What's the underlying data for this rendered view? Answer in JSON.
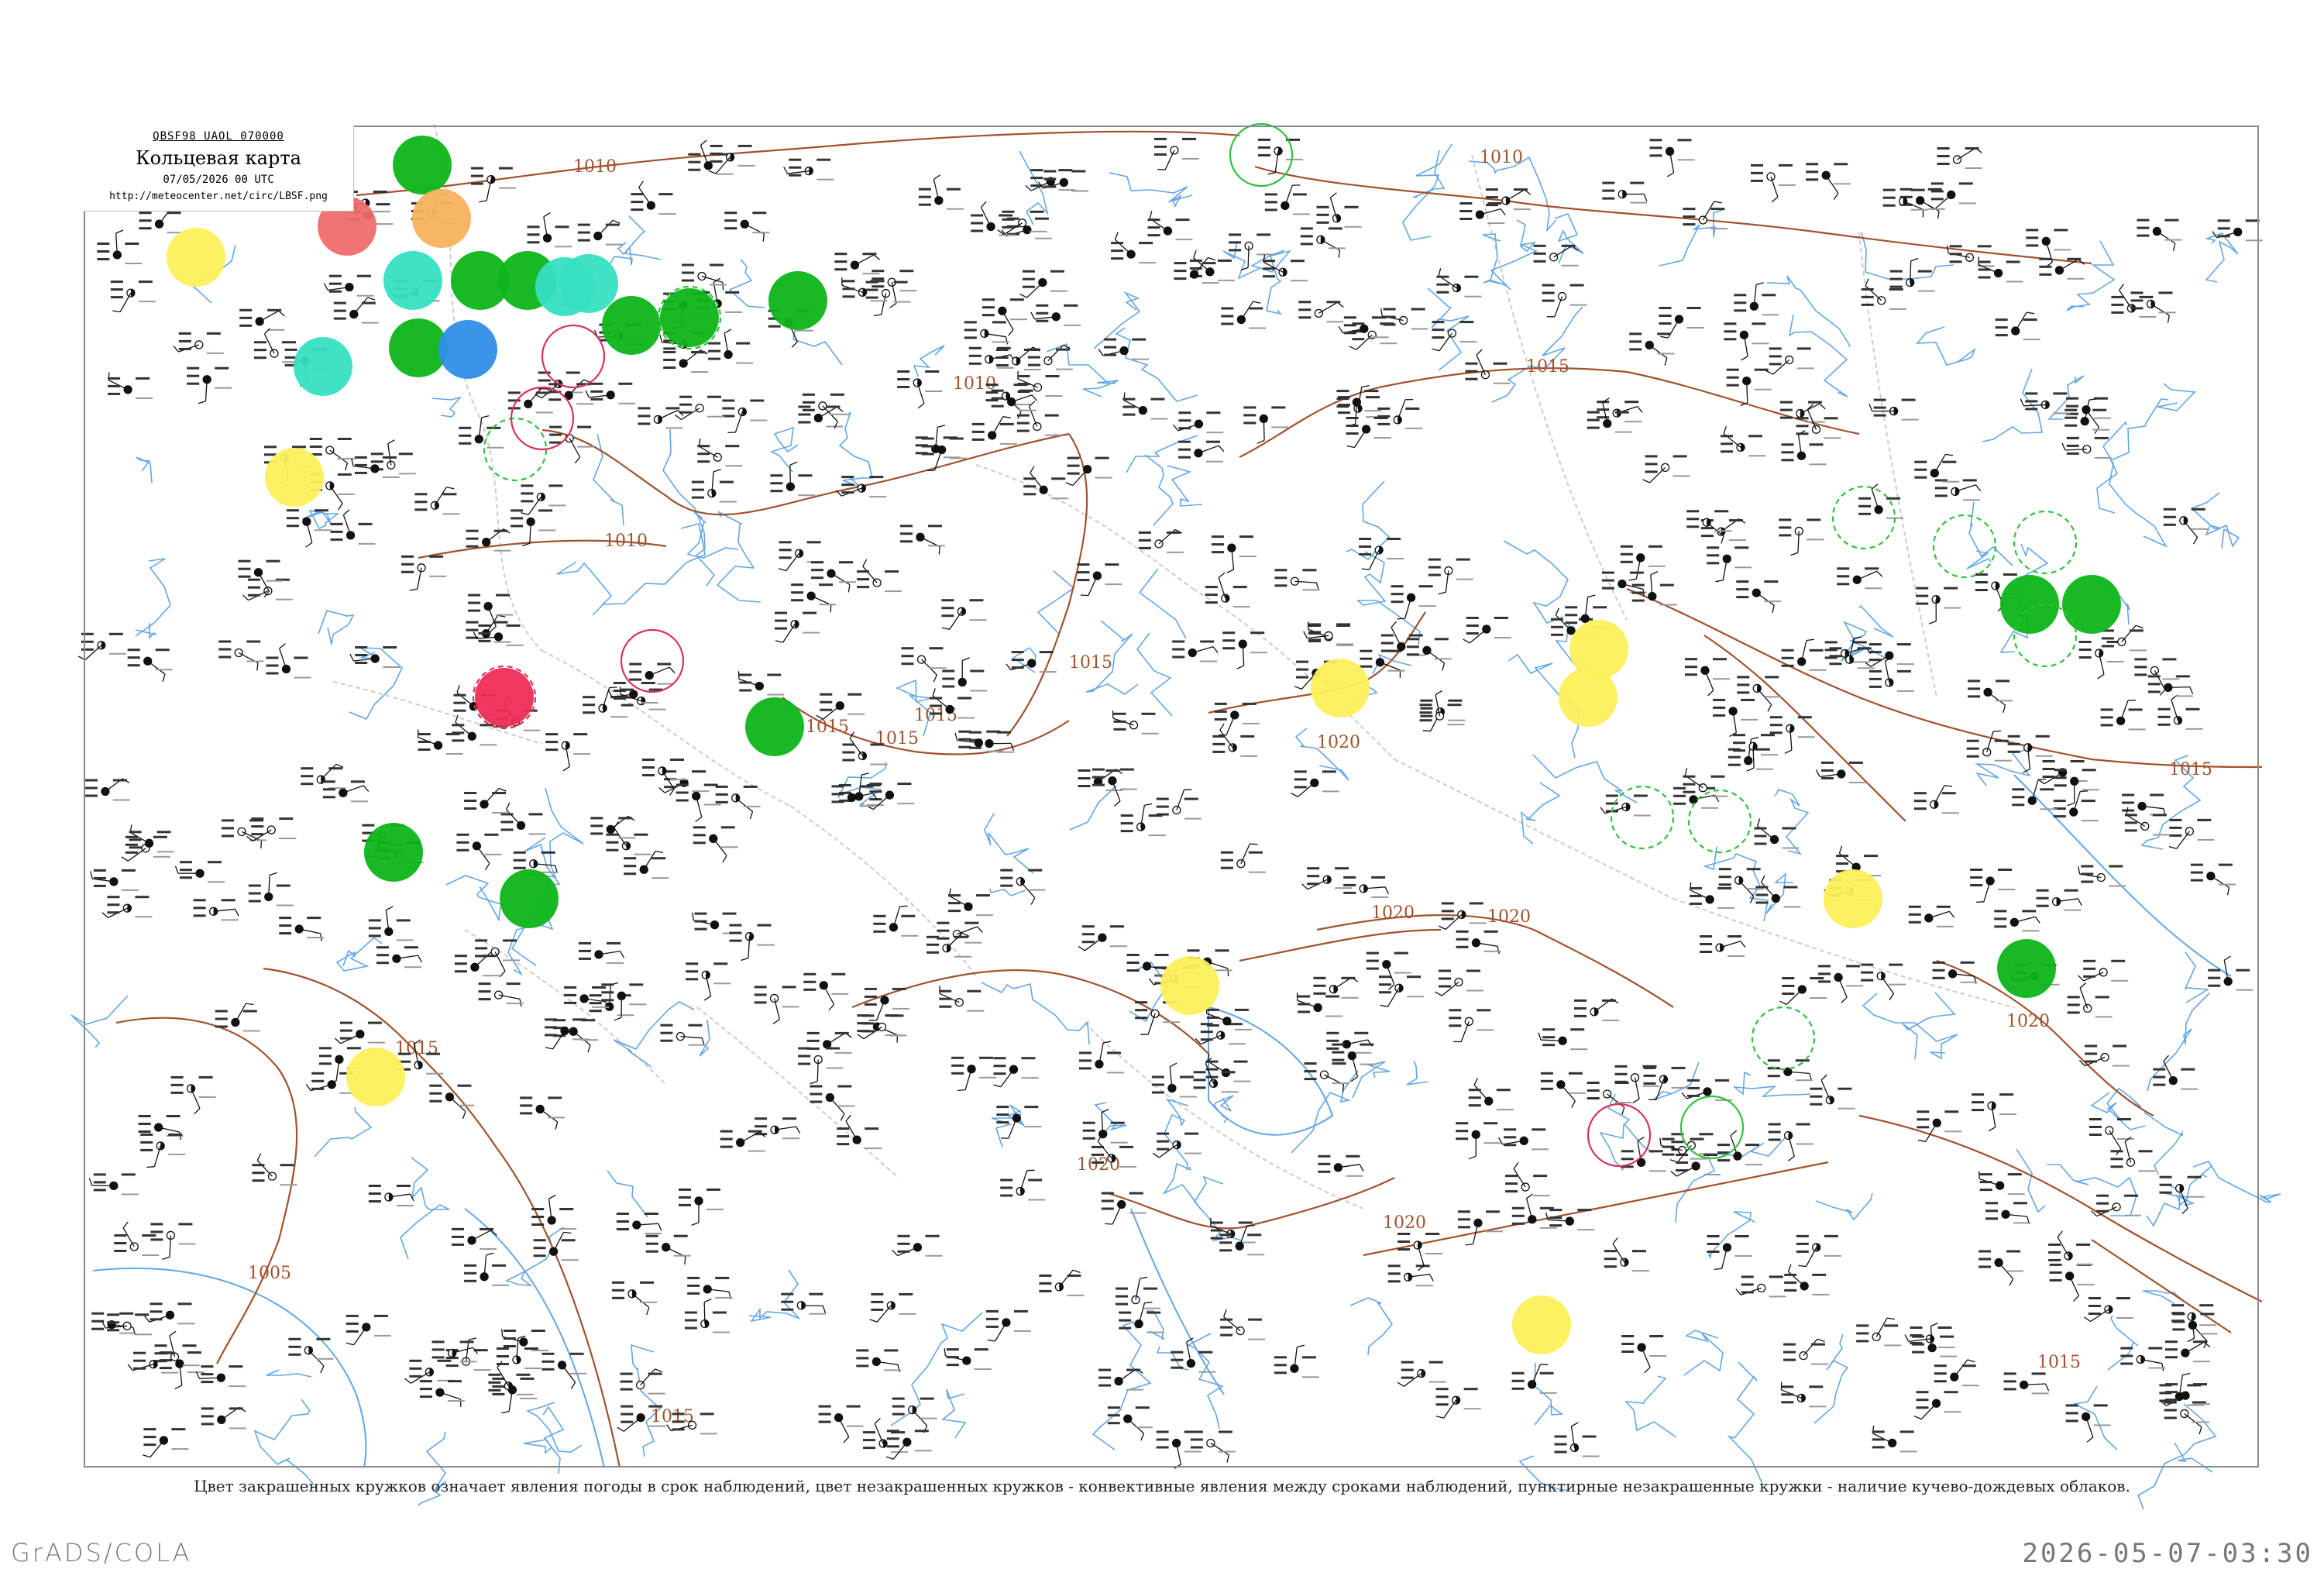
{
  "title_box": {
    "code": "QBSF98  UAOL  070000",
    "title": "Кольцевая карта",
    "datetime": "07/05/2026 00 UTC",
    "url": "http://meteocenter.net/circ/LBSF.png"
  },
  "footnote": "Цвет закрашенных кружков означает явления погоды в срок наблюдений, цвет незакрашенных кружков - конвективные явления между сроками наблюдений, пунктирные незакрашенные кружки - наличие кучево-дождевых облаков.",
  "software_label": "GrADS/COLA",
  "render_timestamp": "2026-05-07-03:30",
  "colors": {
    "isobar": "#a0522d",
    "isobar_label": "#a0522d",
    "water": "#63a6e6",
    "border": "#cccccc",
    "green": "#0db51a",
    "teal": "#35e0c2",
    "yellow": "#fbf05a",
    "red": "#ef2c56",
    "salmon": "#f06d6d",
    "orange": "#f5b25c",
    "blue": "#2f8ee8",
    "green_ring": "#2fc23a",
    "red_ring": "#d8315b"
  },
  "isobar_labels": [
    "1010",
    "1010",
    "1010",
    "1015",
    "1010",
    "1015",
    "1015",
    "1015",
    "1015",
    "1020",
    "1015",
    "1020",
    "1020",
    "1020",
    "1015",
    "1005",
    "1015",
    "1015",
    "1020",
    "1020"
  ],
  "station_legend_icons": [
    "station-plot-icon"
  ],
  "filled_circle_colors": [
    "green",
    "teal",
    "yellow",
    "red",
    "salmon",
    "orange",
    "blue"
  ],
  "ring_types": [
    "green_ring",
    "red_ring"
  ]
}
